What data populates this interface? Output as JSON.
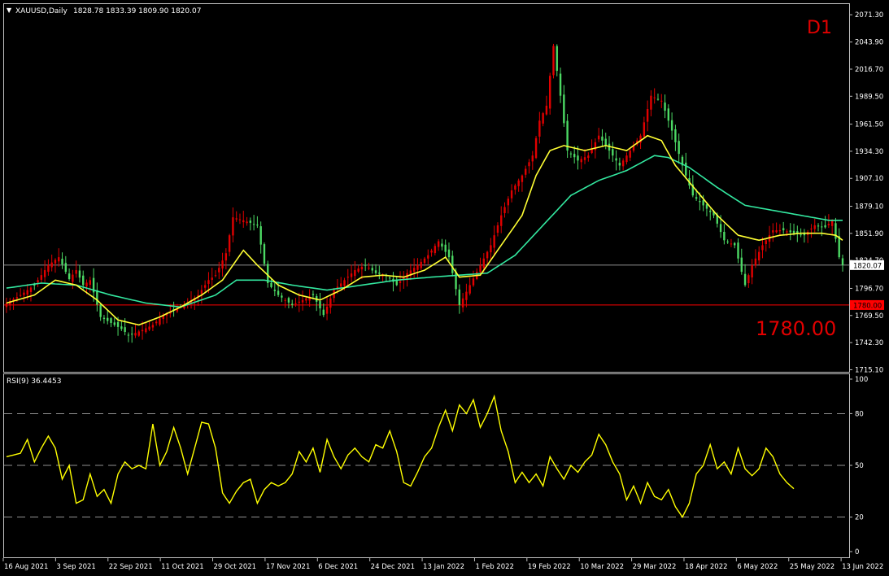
{
  "header": {
    "symbol_arrow": "▼",
    "title": "XAUUSD,Daily",
    "ohlc": "1828.78 1833.39 1809.90 1820.07"
  },
  "timeframe_badge": "D1",
  "level_label": "1780.00",
  "colors": {
    "background": "#000000",
    "grid_frame": "#c0c0c0",
    "bull_candle": "#e10000",
    "bear_candle": "#4cd964",
    "ma_fast": "#ffff33",
    "ma_slow": "#33e8a0",
    "rsi": "#ffff00",
    "price_line": "#c0c0c0",
    "level_line": "#ff0000",
    "badge_text": "#e10000"
  },
  "chart_data": [
    {
      "type": "candlestick",
      "title": "XAUUSD,Daily",
      "ylim": [
        1713,
        2082
      ],
      "y_ticks": [
        "2071.30",
        "2043.90",
        "2016.70",
        "1989.50",
        "1961.50",
        "1934.30",
        "1907.10",
        "1879.10",
        "1851.90",
        "1824.70",
        "1796.70",
        "1769.50",
        "1742.30",
        "1715.10"
      ],
      "x_ticks": [
        "16 Aug 2021",
        "3 Sep 2021",
        "22 Sep 2021",
        "11 Oct 2021",
        "29 Oct 2021",
        "17 Nov 2021",
        "6 Dec 2021",
        "24 Dec 2021",
        "13 Jan 2022",
        "1 Feb 2022",
        "19 Feb 2022",
        "10 Mar 2022",
        "29 Mar 2022",
        "18 Apr 2022",
        "6 May 2022",
        "25 May 2022",
        "13 Jun 2022"
      ],
      "last_close": 1820.07,
      "last_price_label": "1820.07",
      "level": 1780.0,
      "level_price_label": "1780.00",
      "anchors": [
        [
          0,
          1782
        ],
        [
          4,
          1790
        ],
        [
          8,
          1800
        ],
        [
          12,
          1820
        ],
        [
          15,
          1828
        ],
        [
          18,
          1806
        ],
        [
          20,
          1815
        ],
        [
          22,
          1800
        ],
        [
          24,
          1805
        ],
        [
          27,
          1768
        ],
        [
          30,
          1762
        ],
        [
          33,
          1756
        ],
        [
          35,
          1750
        ],
        [
          37,
          1752
        ],
        [
          39,
          1755
        ],
        [
          42,
          1760
        ],
        [
          45,
          1770
        ],
        [
          48,
          1775
        ],
        [
          52,
          1782
        ],
        [
          55,
          1790
        ],
        [
          58,
          1805
        ],
        [
          60,
          1810
        ],
        [
          63,
          1832
        ],
        [
          65,
          1868
        ],
        [
          68,
          1865
        ],
        [
          72,
          1860
        ],
        [
          75,
          1802
        ],
        [
          78,
          1790
        ],
        [
          82,
          1780
        ],
        [
          85,
          1785
        ],
        [
          88,
          1790
        ],
        [
          91,
          1770
        ],
        [
          94,
          1795
        ],
        [
          97,
          1805
        ],
        [
          100,
          1815
        ],
        [
          103,
          1820
        ],
        [
          106,
          1812
        ],
        [
          109,
          1810
        ],
        [
          112,
          1800
        ],
        [
          115,
          1812
        ],
        [
          118,
          1820
        ],
        [
          121,
          1830
        ],
        [
          124,
          1844
        ],
        [
          127,
          1828
        ],
        [
          130,
          1780
        ],
        [
          133,
          1800
        ],
        [
          136,
          1820
        ],
        [
          139,
          1840
        ],
        [
          142,
          1870
        ],
        [
          145,
          1895
        ],
        [
          148,
          1910
        ],
        [
          151,
          1930
        ],
        [
          153,
          1965
        ],
        [
          155,
          1980
        ],
        [
          157,
          2040
        ],
        [
          159,
          1990
        ],
        [
          161,
          1935
        ],
        [
          164,
          1925
        ],
        [
          167,
          1930
        ],
        [
          170,
          1950
        ],
        [
          173,
          1935
        ],
        [
          176,
          1920
        ],
        [
          179,
          1935
        ],
        [
          182,
          1950
        ],
        [
          185,
          1990
        ],
        [
          188,
          1985
        ],
        [
          191,
          1955
        ],
        [
          194,
          1920
        ],
        [
          197,
          1890
        ],
        [
          200,
          1880
        ],
        [
          203,
          1870
        ],
        [
          206,
          1845
        ],
        [
          209,
          1840
        ],
        [
          212,
          1800
        ],
        [
          214,
          1820
        ],
        [
          217,
          1840
        ],
        [
          220,
          1855
        ],
        [
          223,
          1855
        ],
        [
          226,
          1852
        ],
        [
          229,
          1850
        ],
        [
          232,
          1860
        ],
        [
          235,
          1858
        ],
        [
          237,
          1865
        ],
        [
          239,
          1828
        ],
        [
          240,
          1820.07
        ]
      ],
      "ma_fast_anchors": [
        [
          0,
          1782
        ],
        [
          8,
          1790
        ],
        [
          14,
          1805
        ],
        [
          20,
          1800
        ],
        [
          26,
          1785
        ],
        [
          32,
          1765
        ],
        [
          38,
          1760
        ],
        [
          44,
          1768
        ],
        [
          50,
          1778
        ],
        [
          56,
          1790
        ],
        [
          62,
          1805
        ],
        [
          68,
          1835
        ],
        [
          72,
          1820
        ],
        [
          78,
          1800
        ],
        [
          84,
          1790
        ],
        [
          90,
          1785
        ],
        [
          96,
          1795
        ],
        [
          102,
          1808
        ],
        [
          108,
          1810
        ],
        [
          114,
          1808
        ],
        [
          120,
          1815
        ],
        [
          126,
          1828
        ],
        [
          130,
          1808
        ],
        [
          136,
          1810
        ],
        [
          142,
          1840
        ],
        [
          148,
          1870
        ],
        [
          152,
          1910
        ],
        [
          156,
          1935
        ],
        [
          160,
          1940
        ],
        [
          166,
          1935
        ],
        [
          172,
          1940
        ],
        [
          178,
          1935
        ],
        [
          184,
          1950
        ],
        [
          188,
          1945
        ],
        [
          192,
          1920
        ],
        [
          198,
          1895
        ],
        [
          204,
          1870
        ],
        [
          210,
          1850
        ],
        [
          216,
          1845
        ],
        [
          222,
          1850
        ],
        [
          228,
          1852
        ],
        [
          234,
          1852
        ],
        [
          238,
          1850
        ],
        [
          240,
          1845
        ]
      ],
      "ma_slow_anchors": [
        [
          0,
          1797
        ],
        [
          10,
          1802
        ],
        [
          20,
          1800
        ],
        [
          30,
          1790
        ],
        [
          40,
          1782
        ],
        [
          50,
          1778
        ],
        [
          60,
          1790
        ],
        [
          66,
          1805
        ],
        [
          74,
          1805
        ],
        [
          82,
          1800
        ],
        [
          92,
          1795
        ],
        [
          102,
          1800
        ],
        [
          112,
          1805
        ],
        [
          122,
          1808
        ],
        [
          130,
          1810
        ],
        [
          138,
          1812
        ],
        [
          146,
          1830
        ],
        [
          154,
          1860
        ],
        [
          162,
          1890
        ],
        [
          170,
          1905
        ],
        [
          178,
          1915
        ],
        [
          186,
          1930
        ],
        [
          190,
          1928
        ],
        [
          196,
          1918
        ],
        [
          204,
          1898
        ],
        [
          212,
          1880
        ],
        [
          220,
          1875
        ],
        [
          228,
          1870
        ],
        [
          236,
          1865
        ],
        [
          240,
          1865
        ]
      ]
    },
    {
      "type": "line",
      "title": "RSI(9) 36.4453",
      "ylim": [
        0,
        100
      ],
      "y_ticks": [
        100,
        80,
        50,
        20,
        0
      ],
      "levels": [
        80,
        50,
        20
      ],
      "series": [
        {
          "name": "RSI(9)",
          "anchors": [
            [
              0,
              55
            ],
            [
              4,
              57
            ],
            [
              6,
              65
            ],
            [
              8,
              52
            ],
            [
              10,
              60
            ],
            [
              12,
              67
            ],
            [
              14,
              60
            ],
            [
              16,
              42
            ],
            [
              18,
              50
            ],
            [
              20,
              28
            ],
            [
              22,
              30
            ],
            [
              24,
              45
            ],
            [
              26,
              32
            ],
            [
              28,
              36
            ],
            [
              30,
              28
            ],
            [
              32,
              45
            ],
            [
              34,
              52
            ],
            [
              36,
              48
            ],
            [
              38,
              50
            ],
            [
              40,
              48
            ],
            [
              42,
              74
            ],
            [
              44,
              50
            ],
            [
              46,
              58
            ],
            [
              48,
              72
            ],
            [
              50,
              60
            ],
            [
              52,
              45
            ],
            [
              54,
              60
            ],
            [
              56,
              75
            ],
            [
              58,
              74
            ],
            [
              60,
              60
            ],
            [
              62,
              34
            ],
            [
              64,
              28
            ],
            [
              66,
              35
            ],
            [
              68,
              40
            ],
            [
              70,
              42
            ],
            [
              72,
              28
            ],
            [
              74,
              36
            ],
            [
              76,
              40
            ],
            [
              78,
              38
            ],
            [
              80,
              40
            ],
            [
              82,
              45
            ],
            [
              84,
              58
            ],
            [
              86,
              52
            ],
            [
              88,
              60
            ],
            [
              90,
              46
            ],
            [
              92,
              65
            ],
            [
              94,
              55
            ],
            [
              96,
              48
            ],
            [
              98,
              56
            ],
            [
              100,
              60
            ],
            [
              102,
              55
            ],
            [
              104,
              52
            ],
            [
              106,
              62
            ],
            [
              108,
              60
            ],
            [
              110,
              70
            ],
            [
              112,
              58
            ],
            [
              114,
              40
            ],
            [
              116,
              38
            ],
            [
              118,
              46
            ],
            [
              120,
              55
            ],
            [
              122,
              60
            ],
            [
              124,
              72
            ],
            [
              126,
              82
            ],
            [
              128,
              70
            ],
            [
              130,
              85
            ],
            [
              132,
              80
            ],
            [
              134,
              88
            ],
            [
              136,
              72
            ],
            [
              138,
              80
            ],
            [
              140,
              90
            ],
            [
              142,
              70
            ],
            [
              144,
              58
            ],
            [
              146,
              40
            ],
            [
              148,
              46
            ],
            [
              150,
              40
            ],
            [
              152,
              45
            ],
            [
              154,
              38
            ],
            [
              156,
              55
            ],
            [
              158,
              48
            ],
            [
              160,
              42
            ],
            [
              162,
              50
            ],
            [
              164,
              46
            ],
            [
              166,
              52
            ],
            [
              168,
              56
            ],
            [
              170,
              68
            ],
            [
              172,
              62
            ],
            [
              174,
              52
            ],
            [
              176,
              45
            ],
            [
              178,
              30
            ],
            [
              180,
              38
            ],
            [
              182,
              28
            ],
            [
              184,
              40
            ],
            [
              186,
              32
            ],
            [
              188,
              30
            ],
            [
              190,
              36
            ],
            [
              192,
              26
            ],
            [
              194,
              20
            ],
            [
              196,
              28
            ],
            [
              198,
              45
            ],
            [
              200,
              50
            ],
            [
              202,
              62
            ],
            [
              204,
              48
            ],
            [
              206,
              52
            ],
            [
              208,
              45
            ],
            [
              210,
              60
            ],
            [
              212,
              48
            ],
            [
              214,
              44
            ],
            [
              216,
              48
            ],
            [
              218,
              60
            ],
            [
              220,
              55
            ],
            [
              222,
              45
            ],
            [
              224,
              40
            ],
            [
              226,
              36.4453
            ]
          ]
        }
      ]
    }
  ]
}
